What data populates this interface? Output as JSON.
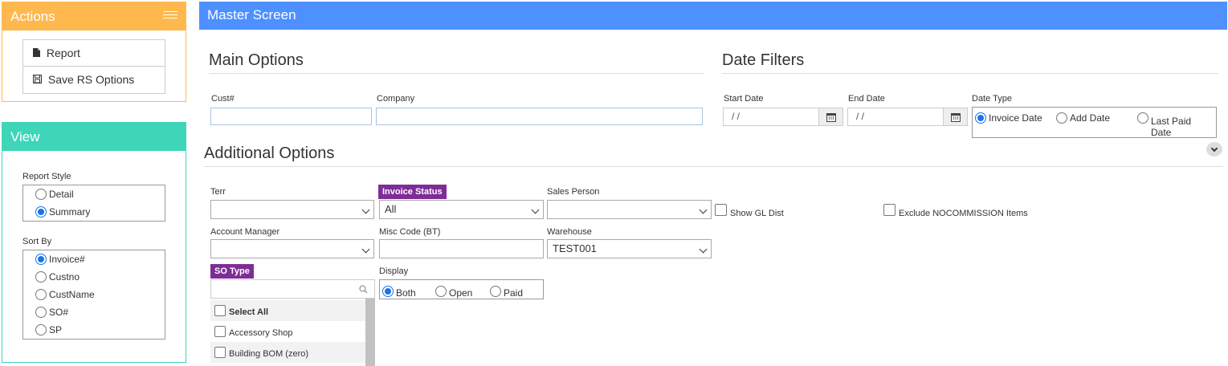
{
  "actions": {
    "title": "Actions",
    "items": [
      {
        "label": "Report",
        "icon": "file-icon"
      },
      {
        "label": "Save RS Options",
        "icon": "save-icon"
      }
    ]
  },
  "view": {
    "title": "View",
    "report_style": {
      "label": "Report Style",
      "options": [
        "Detail",
        "Summary"
      ],
      "selected": "Summary"
    },
    "sort_by": {
      "label": "Sort By",
      "options": [
        "Invoice#",
        "Custno",
        "CustName",
        "SO#",
        "SP"
      ],
      "selected": "Invoice#"
    }
  },
  "master": {
    "title": "Master Screen"
  },
  "main_options": {
    "title": "Main Options",
    "cust_label": "Cust#",
    "cust_value": "",
    "company_label": "Company",
    "company_value": ""
  },
  "date_filters": {
    "title": "Date Filters",
    "start_label": "Start Date",
    "start_value": " /  /",
    "end_label": "End Date",
    "end_value": " /  /",
    "type_label": "Date Type",
    "type_options": [
      "Invoice Date",
      "Add Date",
      "Last Paid Date"
    ],
    "type_selected": "Invoice Date"
  },
  "additional": {
    "title": "Additional Options",
    "terr_label": "Terr",
    "terr_value": "",
    "invoice_status_label": "Invoice Status",
    "invoice_status_value": "All",
    "sales_person_label": "Sales Person",
    "sales_person_value": "",
    "show_gl_label": "Show GL Dist",
    "exclude_label": "Exclude NOCOMMISSION Items",
    "account_manager_label": "Account Manager",
    "account_manager_value": "",
    "misc_code_label": "Misc Code (BT)",
    "misc_code_value": "",
    "warehouse_label": "Warehouse",
    "warehouse_value": "TEST001",
    "so_type_label": "SO Type",
    "so_type_search": "",
    "so_type_items": [
      "Select All",
      "Accessory Shop",
      "Building BOM (zero)"
    ],
    "display_label": "Display",
    "display_options": [
      "Both",
      "Open",
      "Paid"
    ],
    "display_selected": "Both"
  },
  "colors": {
    "actions_accent": "#ffb84d",
    "view_accent": "#3ed5b9",
    "master_accent": "#4d90fe",
    "tag_purple": "#7e2d97",
    "radio_blue": "#1a73e8"
  }
}
